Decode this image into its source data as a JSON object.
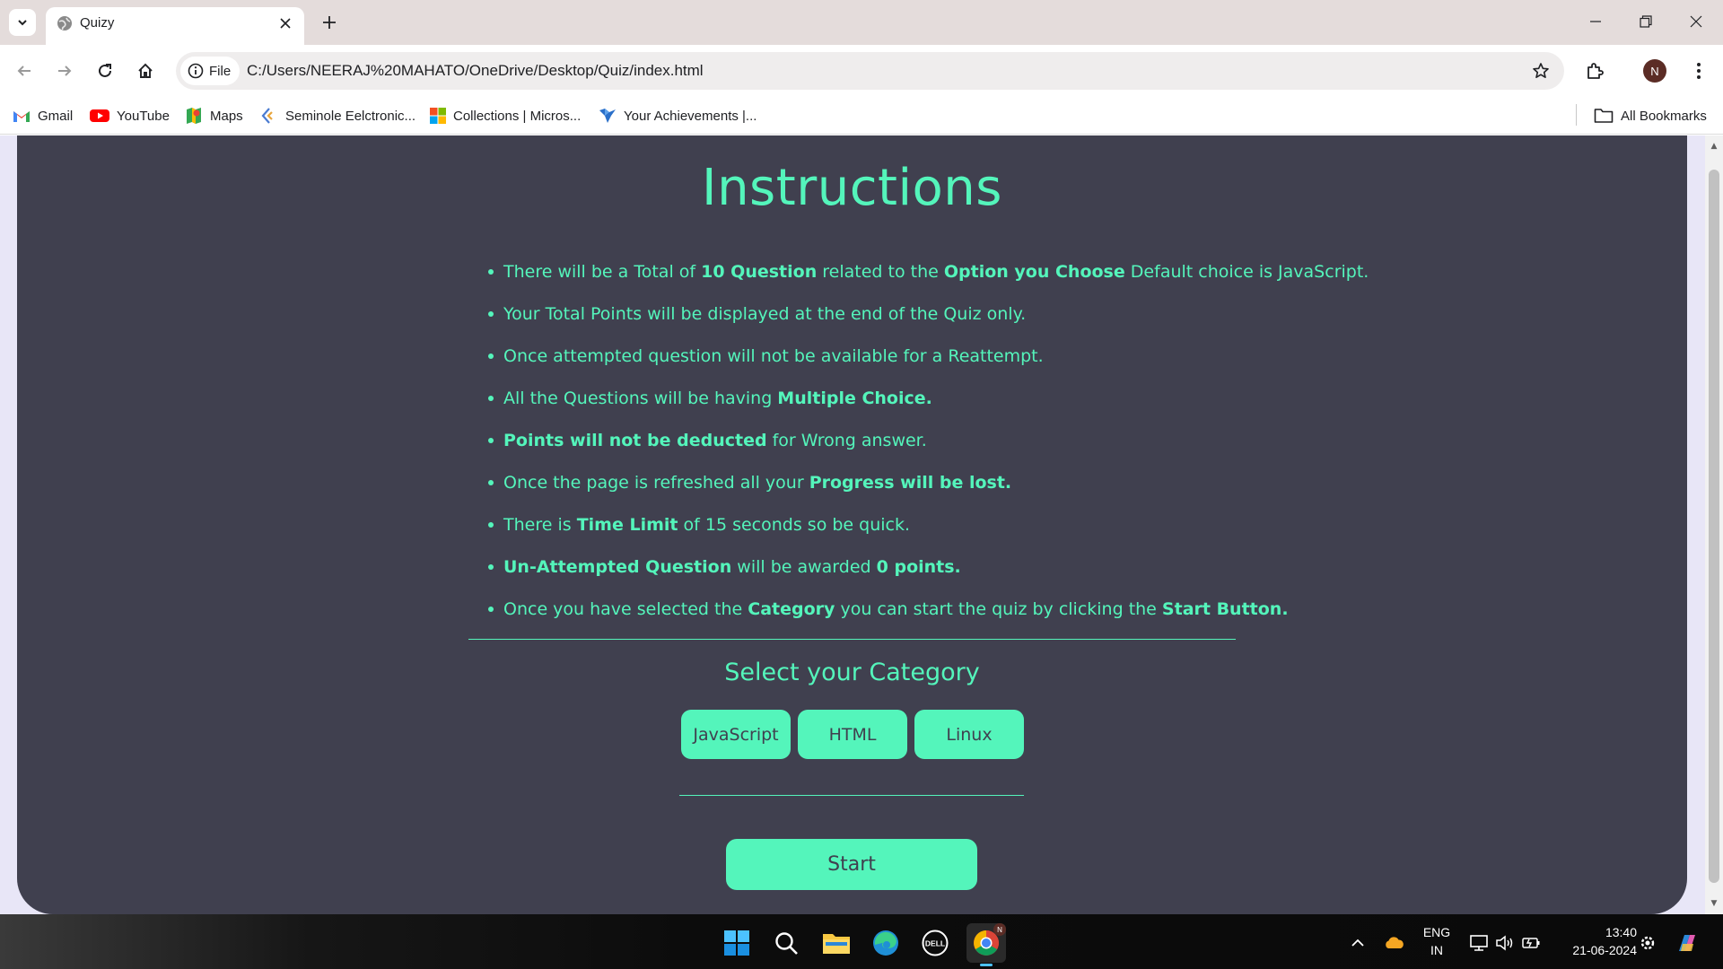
{
  "browser": {
    "tab_title": "Quizy",
    "site_chip_label": "File",
    "url": "C:/Users/NEERAJ%20MAHATO/OneDrive/Desktop/Quiz/index.html",
    "avatar_letter": "N",
    "bookmarks": [
      {
        "label": "Gmail",
        "icon": "gmail-icon"
      },
      {
        "label": "YouTube",
        "icon": "youtube-icon"
      },
      {
        "label": "Maps",
        "icon": "maps-icon"
      },
      {
        "label": "Seminole Eelctronic...",
        "icon": "seminole-icon"
      },
      {
        "label": "Collections | Micros...",
        "icon": "microsoft-icon"
      },
      {
        "label": "Your Achievements |...",
        "icon": "achievements-icon"
      }
    ],
    "all_bookmarks_label": "All Bookmarks"
  },
  "page": {
    "title": "Instructions",
    "instructions": [
      {
        "parts": [
          {
            "t": "There will be a Total of "
          },
          {
            "t": "10 Question",
            "b": true
          },
          {
            "t": " related to the "
          },
          {
            "t": "Option you Choose",
            "b": true
          },
          {
            "t": " Default choice is JavaScript."
          }
        ]
      },
      {
        "parts": [
          {
            "t": "Your Total Points will be displayed at the end of the Quiz only."
          }
        ]
      },
      {
        "parts": [
          {
            "t": "Once attempted question will not be available for a Reattempt."
          }
        ]
      },
      {
        "parts": [
          {
            "t": "All the Questions will be having "
          },
          {
            "t": "Multiple Choice.",
            "b": true
          }
        ]
      },
      {
        "parts": [
          {
            "t": "Points will not be deducted",
            "b": true
          },
          {
            "t": " for Wrong answer."
          }
        ]
      },
      {
        "parts": [
          {
            "t": "Once the page is refreshed all your "
          },
          {
            "t": "Progress will be lost.",
            "b": true
          }
        ]
      },
      {
        "parts": [
          {
            "t": "There is "
          },
          {
            "t": "Time Limit",
            "b": true
          },
          {
            "t": " of 15 seconds so be quick."
          }
        ]
      },
      {
        "parts": [
          {
            "t": "Un-Attempted Question",
            "b": true
          },
          {
            "t": " will be awarded "
          },
          {
            "t": "0 points.",
            "b": true
          }
        ]
      },
      {
        "parts": [
          {
            "t": "Once you have selected the "
          },
          {
            "t": "Category",
            "b": true
          },
          {
            "t": " you can start the quiz by clicking the "
          },
          {
            "t": "Start Button.",
            "b": true
          }
        ]
      }
    ],
    "category_title": "Select your Category",
    "categories": [
      "JavaScript",
      "HTML",
      "Linux"
    ],
    "start_label": "Start"
  },
  "taskbar": {
    "lang_line1": "ENG",
    "lang_line2": "IN",
    "time": "13:40",
    "date": "21-06-2024",
    "chrome_badge": "N"
  },
  "colors": {
    "accent": "#54f5bb",
    "card_bg": "#40404f",
    "page_bg": "#e8e6f7"
  }
}
